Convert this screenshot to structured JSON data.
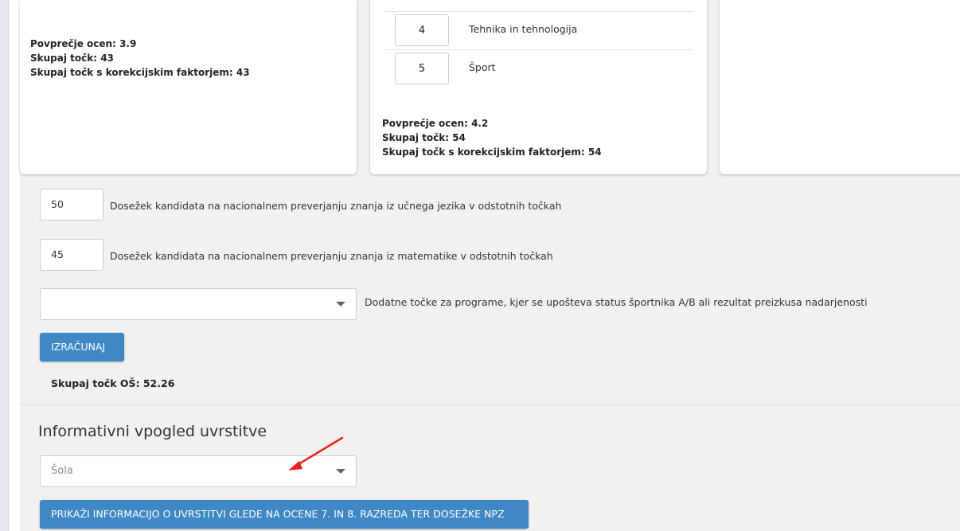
{
  "card1": {
    "avg_label": "Povprečje ocen: 3.9",
    "total_label": "Skupaj točk: 43",
    "total_corr_label": "Skupaj točk s korekcijskim faktorjem: 43"
  },
  "card2": {
    "rows": [
      {
        "grade": "4",
        "subject": "Tehnika in tehnologija"
      },
      {
        "grade": "5",
        "subject": "Šport"
      }
    ],
    "avg_label": "Povprečje ocen: 4.2",
    "total_label": "Skupaj točk: 54",
    "total_corr_label": "Skupaj točk s korekcijskim faktorjem: 54"
  },
  "npz": {
    "lang_value": "50",
    "lang_label": "Dosežek kandidata na nacionalnem preverjanju znanja iz učnega jezika v odstotnih točkah",
    "math_value": "45",
    "math_label": "Dosežek kandidata na nacionalnem preverjanju znanja iz matematike v odstotnih točkah"
  },
  "extra": {
    "select_value": "",
    "label": "Dodatne točke za programe, kjer se upošteva status športnika A/B ali rezultat preizkusa nadarjenosti"
  },
  "calc_button": "IZRAČUNAJ",
  "total_os": "Skupaj točk OŠ: 52.26",
  "placement": {
    "title": "Informativni vpogled uvrstitve",
    "school_placeholder": "Šola",
    "show_button": "PRIKAŽI INFORMACIJO O UVRSTITVI GLEDE NA OCENE 7. IN 8. RAZREDA TER DOSEŽKE NPZ"
  },
  "colors": {
    "accent": "#3f88c5",
    "arrow": "#e8201c"
  }
}
